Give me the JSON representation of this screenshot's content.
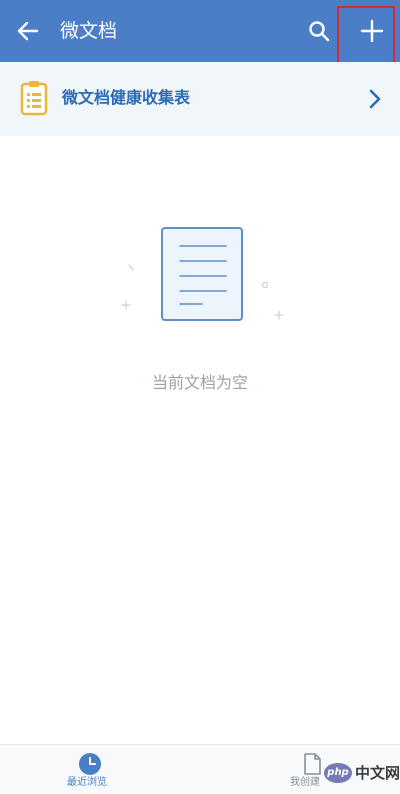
{
  "header": {
    "title": "微文档",
    "back_icon": "arrow-left-icon",
    "search_icon": "search-icon",
    "add_icon": "plus-icon",
    "background_color": "#4a7fc7"
  },
  "pinned_item": {
    "label": "微文档健康收集表",
    "icon": "clipboard-list-icon",
    "icon_color": "#e7b83a",
    "label_color": "#2c6bb6"
  },
  "empty_state": {
    "message": "当前文档为空",
    "illustration": "document-icon"
  },
  "bottom_nav": {
    "tabs": [
      {
        "label": "最近浏览",
        "icon": "clock-icon",
        "active": true
      },
      {
        "label": "我创建",
        "icon": "file-icon",
        "active": false
      }
    ]
  },
  "watermark": {
    "logo": "php",
    "site": "中文网"
  },
  "highlight_color": "#d9293a"
}
